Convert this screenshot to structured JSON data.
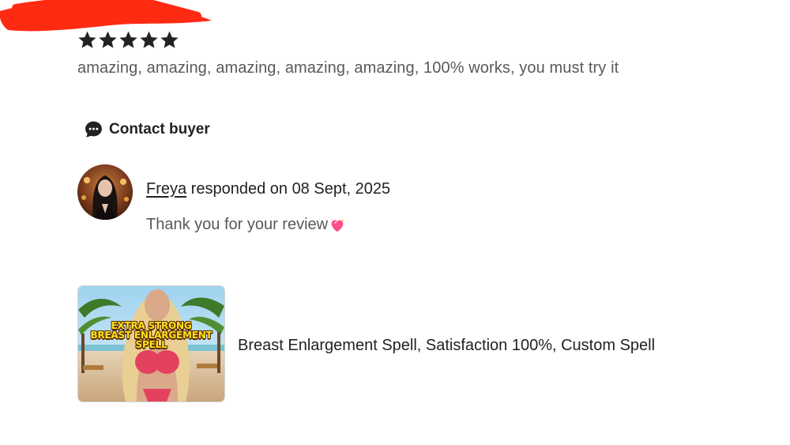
{
  "review": {
    "rating": 5,
    "rating_max": 5,
    "text": "amazing, amazing, amazing, amazing, amazing, 100% works, you must try it"
  },
  "contact": {
    "label": "Contact buyer",
    "icon": "chat-bubble-icon"
  },
  "response": {
    "seller_name": "Freya",
    "meta": " responded on 08 Sept, 2025",
    "text": "Thank you for your review",
    "emoji_icon": "sparkling-heart-icon"
  },
  "listing": {
    "title": "Breast Enlargement Spell, Satisfaction 100%, Custom Spell",
    "thumbnail_caption": [
      "EXTRA STRONG",
      "BREAST ENLARGEMENT",
      "SPELL"
    ]
  },
  "colors": {
    "text_primary": "#222222",
    "text_secondary": "#595959",
    "redaction": "#ff2a12",
    "caption": "#ffe21a"
  }
}
